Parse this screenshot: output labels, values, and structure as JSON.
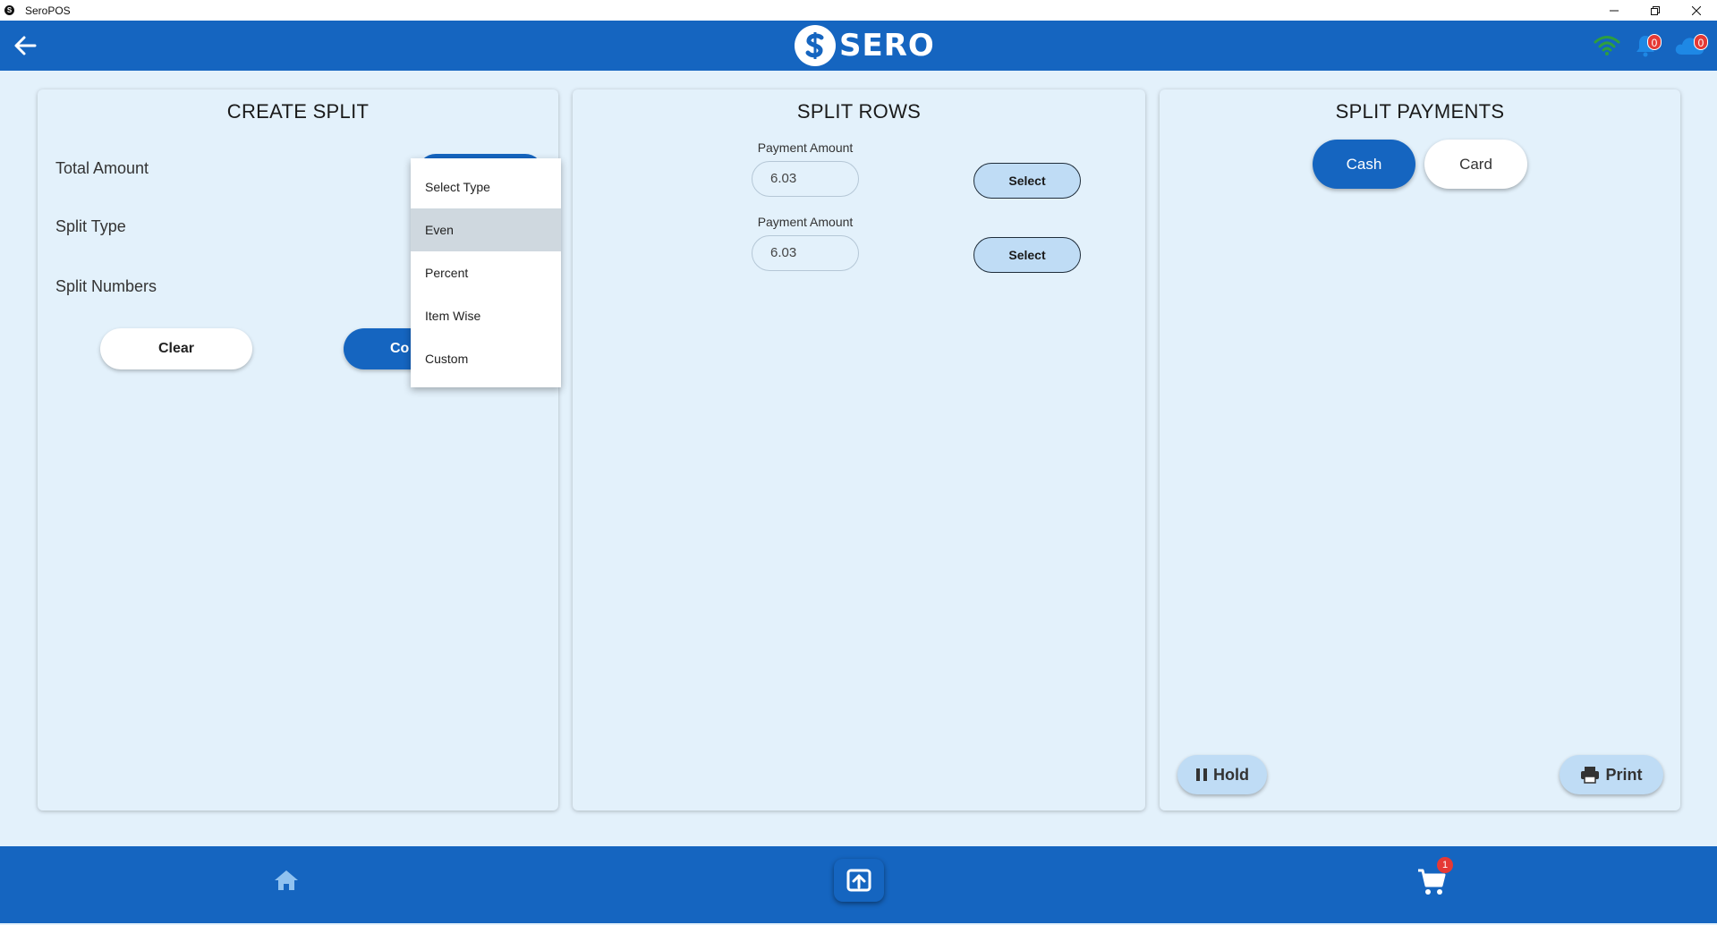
{
  "window": {
    "title": "SeroPOS",
    "controls": [
      "minimize-icon",
      "restore-icon",
      "close-icon"
    ]
  },
  "header": {
    "logo_text": "SERO",
    "notification_count": "0",
    "cloud_count": "0",
    "colors": {
      "primary": "#1565c0",
      "wifi": "#2e9e3e",
      "badge": "#e53935"
    }
  },
  "create_split": {
    "title": "CREATE SPLIT",
    "total_amount_label": "Total Amount",
    "split_type_label": "Split Type",
    "split_numbers_label": "Split Numbers",
    "clear_label": "Clear",
    "confirm_label_visible": "Co",
    "dropdown": {
      "items": [
        "Select Type",
        "Even",
        "Percent",
        "Item Wise",
        "Custom"
      ],
      "highlighted": "Even"
    }
  },
  "split_rows": {
    "title": "SPLIT ROWS",
    "rows": [
      {
        "label": "Payment Amount",
        "amount": "6.03",
        "action": "Select"
      },
      {
        "label": "Payment Amount",
        "amount": "6.03",
        "action": "Select"
      }
    ]
  },
  "split_payments": {
    "title": "SPLIT PAYMENTS",
    "cash_label": "Cash",
    "card_label": "Card",
    "hold_label": "Hold",
    "print_label": "Print"
  },
  "bottom_nav": {
    "cart_count": "1"
  }
}
